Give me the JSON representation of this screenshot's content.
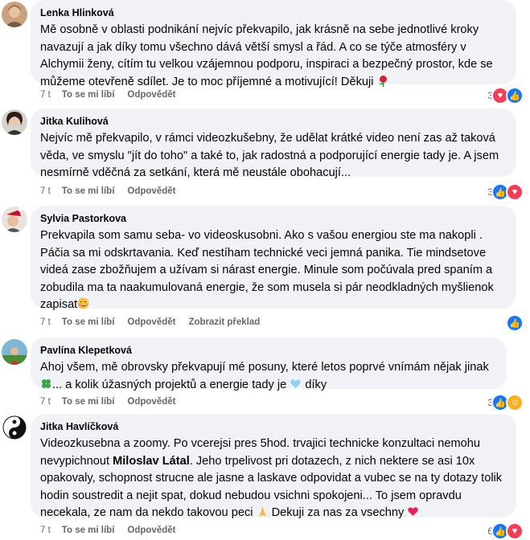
{
  "comments": [
    {
      "author": "Lenka Hlinková",
      "text": "Mě osobně v oblasti podnikání nejvíc překvapilo, jak krásně na sebe jednotlivé kroky navazují a jak díky tomu všechno dává větší smysl a řád. A co se týče atmosféry v Alchymii ženy, cítím tu velkou vzájemnou podporu, inspiraci a bezpečný prostor, kde se můžeme otevřeně sdílet. Je to moc příjemné a motivující! Děkuji",
      "time": "7 t",
      "like": "To se mi líbí",
      "reply": "Odpovědět",
      "reactions_count": "3",
      "reactions": [
        "love-icon",
        "like-icon"
      ]
    },
    {
      "author": "Jitka Kulihová",
      "text": "Nejvíc mě překvapilo, v rámci videozkušebny, že udělat krátké video není zas až taková věda, ve smyslu \"jít do toho\" a také to, jak radostná a podporující energie tady je. A jsem nesmírně vděčná za setkání, která mě neustále obohacují...",
      "time": "7 t",
      "like": "To se mi líbí",
      "reply": "Odpovědět",
      "reactions_count": "3",
      "reactions": [
        "like-icon",
        "love-icon"
      ]
    },
    {
      "author": "Sylvia Pastorkova",
      "text": "Prekvapila som samu seba- vo videoskusobni. Ako s vašou energiou ste ma nakopli . Páčia sa mi odskrtavania. Keď nestíham technické veci jemná panika. Tie mindsetove videá zase zbožňujem a užívam si nárast energie. Minule som počúvala pred spaním a zobudila ma ta naakumulovaná energie, že som musela si pár neodkladných myšlienok zapisat",
      "time": "7 t",
      "like": "To se mi líbí",
      "reply": "Odpovědět",
      "translate": "Zobrazit překlad",
      "reactions_count": "",
      "reactions": [
        "like-icon"
      ]
    },
    {
      "author": "Pavlína Klepetková",
      "text_a": "Ahoj všem, mě obrovsky překvapují mé posuny, které letos poprvé vnímám nějak jinak",
      "text_b": "... a kolik úžasných projektů a energie tady je",
      "text_c": "díky",
      "time": "7 t",
      "like": "To se mi líbí",
      "reply": "Odpovědět",
      "reactions_count": "3",
      "reactions": [
        "like-icon",
        "care-icon"
      ]
    },
    {
      "author": "Jitka Havlíčková",
      "text_a": "Videozkusebna a zoomy. Po vcerejsi pres 5hod. trvajici technicke konzultaci nemohu nevypichnout",
      "text_mention": "Miloslav Látal",
      "text_b": ". Jeho trpelivost pri dotazech, z nich nektere se asi 10x opakovaly, schopnost strucne ale jasne a laskave odpovidat a vubec se na ty dotazy tolik hodin soustredit a nejit spat, dokud nebudou vsichni spokojeni... To jsem opravdu necekala, ze nam da nekdo takovou peci",
      "text_c": "Dekuji za nas za vsechny",
      "time": "7 t",
      "like": "To se mi líbí",
      "reply": "Odpovědět",
      "reactions_count": "6",
      "reactions": [
        "like-icon",
        "love-icon"
      ]
    }
  ],
  "colors": {
    "bubble": "#f0f2f5",
    "meta": "#65676b",
    "like": "#1877f2",
    "love": "#f33e58"
  }
}
